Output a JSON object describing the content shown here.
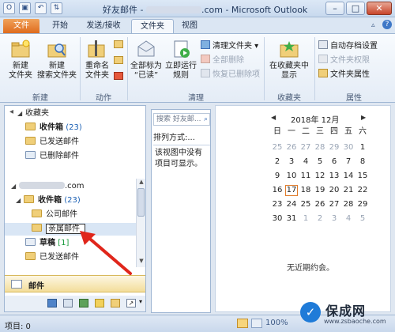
{
  "window": {
    "title": "好友邮件 - ",
    "title_suffix": ".com - Microsoft Outlook",
    "controls": {
      "minimize": "–",
      "maximize": "□",
      "close": "✕"
    }
  },
  "quick_access": {
    "save_icon": "save-icon",
    "undo_icon": "undo-icon",
    "send_receive_icon": "send-receive-icon"
  },
  "tabs": [
    {
      "label": "文件"
    },
    {
      "label": "开始"
    },
    {
      "label": "发送/接收"
    },
    {
      "label": "文件夹"
    },
    {
      "label": "视图"
    }
  ],
  "ribbon": {
    "groups": {
      "new": {
        "label": "新建",
        "new_folder": [
          "新建",
          "文件夹"
        ],
        "new_search_folder": [
          "新建",
          "搜索文件夹"
        ]
      },
      "actions": {
        "label": "动作",
        "rename_folder": [
          "重命名",
          "文件夹"
        ]
      },
      "cleanup": {
        "label": "清理",
        "mark_all_read": [
          "全部标为",
          "“已读”"
        ],
        "run_rules_now": [
          "立即运行",
          "规则"
        ],
        "clean_up_folder": "清理文件夹",
        "delete_all": "全部删除",
        "recover_deleted": "恢复已删除项"
      },
      "favorites": {
        "label": "收藏夹",
        "show_in_favorites": [
          "在收藏夹中",
          "显示"
        ]
      },
      "properties": {
        "label": "属性",
        "autoarchive": "自动存档设置",
        "folder_permissions": "文件夹权限",
        "folder_properties": "文件夹属性"
      }
    }
  },
  "nav": {
    "favorites_header": "收藏夹",
    "favorites": [
      {
        "label": "收件箱",
        "count": "(23)"
      },
      {
        "label": "已发送邮件"
      },
      {
        "label": "已删除邮件"
      }
    ],
    "account": ".com",
    "inbox": {
      "label": "收件箱",
      "count": "(23)"
    },
    "subfolders": [
      {
        "label": "公司邮件"
      },
      {
        "label": "亲属邮件"
      }
    ],
    "drafts": {
      "label": "草稿",
      "count": "[1]"
    },
    "sent": {
      "label": "已发送邮件"
    },
    "module": "邮件"
  },
  "list": {
    "search_placeholder": "搜索 好友邮...",
    "sort_label": "排列方式:...",
    "empty_message": [
      "该视图中没有",
      "项目可显示。"
    ]
  },
  "calendar": {
    "month_title": "2018年 12月",
    "weekdays": [
      "日",
      "一",
      "二",
      "三",
      "四",
      "五",
      "六"
    ],
    "weeks": [
      [
        "25",
        "26",
        "27",
        "28",
        "29",
        "30",
        "1"
      ],
      [
        "2",
        "3",
        "4",
        "5",
        "6",
        "7",
        "8"
      ],
      [
        "9",
        "10",
        "11",
        "12",
        "13",
        "14",
        "15"
      ],
      [
        "16",
        "17",
        "18",
        "19",
        "20",
        "21",
        "22"
      ],
      [
        "23",
        "24",
        "25",
        "26",
        "27",
        "28",
        "29"
      ],
      [
        "30",
        "31",
        "1",
        "2",
        "3",
        "4",
        "5"
      ]
    ],
    "today": "17",
    "no_appointments": "无近期约会。"
  },
  "status": {
    "items": "项目: 0"
  },
  "watermark": {
    "title": "保成网",
    "url": "www.zsbaoche.com"
  },
  "colors": {
    "accent": "#df6b1d",
    "arrow": "#e0261b",
    "today_border": "#e07b2a"
  }
}
